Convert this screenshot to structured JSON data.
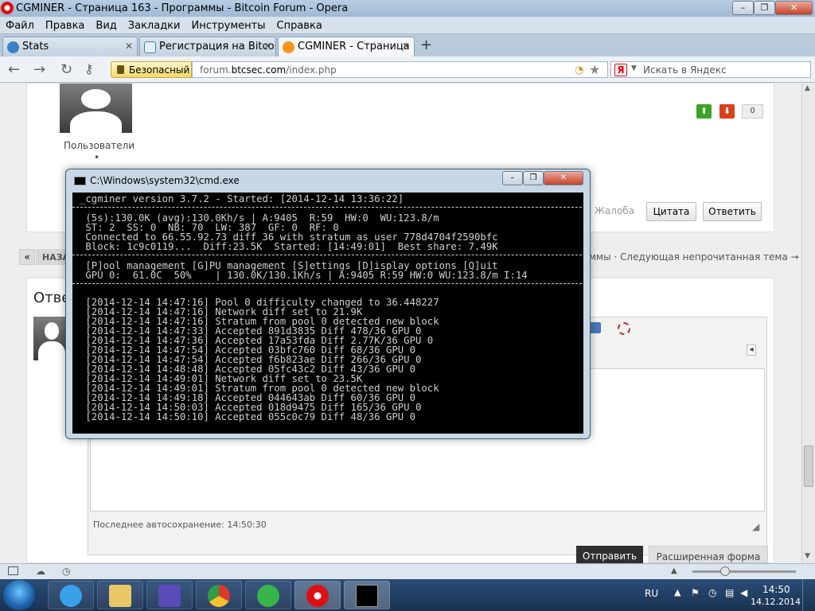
{
  "window": {
    "title": "CGMINER - Страница 163 - Программы - Bitcoin Forum - Opera",
    "controls": [
      "–",
      "❐",
      "✕"
    ]
  },
  "menu": [
    "Файл",
    "Правка",
    "Вид",
    "Закладки",
    "Инструменты",
    "Справка"
  ],
  "tabs": [
    {
      "label": "Stats",
      "active": false
    },
    {
      "label": "Регистрация на Bitcoi...",
      "active": false
    },
    {
      "label": "CGMINER - Страница ...",
      "active": true
    }
  ],
  "newtab": "+",
  "address": {
    "security": "Безопасный",
    "host": "forum.",
    "domain": "btcsec.com",
    "path": "/index.php",
    "search_placeholder": "Искать в Яндекс",
    "search_engine": "Я"
  },
  "forum": {
    "user_group": "Пользователи",
    "bullet": "•",
    "rating": "0",
    "complaint": "Жалоба",
    "quote": "Цитата",
    "reply": "Ответить",
    "prev_arrow": "«",
    "prev_label": "НАЗА",
    "next_text": "ммы · Следующая непрочитанная тема →",
    "reply_heading": "Отве",
    "autosave": "Последнее автосохранение: 14:50:30",
    "send": "Отправить",
    "extended": "Расширенная форма"
  },
  "cmd": {
    "title": "C:\\Windows\\system32\\cmd.exe",
    "header": "_cgminer version 3.7.2 - Started: [2014-12-14 13:36:22]",
    "status": [
      " (5s):130.0K (avg):130.0Kh/s | A:9405  R:59  HW:0  WU:123.8/m",
      " ST: 2  SS: 0  NB: 70  LW: 387  GF: 0  RF: 0",
      " Connected to 66.55.92.73 diff 36 with stratum as user 778d4704f2590bfc",
      " Block: 1c9c0119...  Diff:23.5K  Started: [14:49:01]  Best share: 7.49K"
    ],
    "menu_line": " [P]ool management [G]PU management [S]ettings [D]isplay options [Q]uit",
    "gpu_line": " GPU 0:  61.0C  50%    | 130.0K/130.1Kh/s | A:9405 R:59 HW:0 WU:123.8/m I:14",
    "log": [
      " [2014-12-14 14:47:16] Pool 0 difficulty changed to 36.448227",
      " [2014-12-14 14:47:16] Network diff set to 21.9K",
      " [2014-12-14 14:47:16] Stratum from pool 0 detected new block",
      " [2014-12-14 14:47:33] Accepted 891d3835 Diff 478/36 GPU 0",
      " [2014-12-14 14:47:36] Accepted 17a53fda Diff 2.77K/36 GPU 0",
      " [2014-12-14 14:47:54] Accepted 03bfc760 Diff 68/36 GPU 0",
      " [2014-12-14 14:47:54] Accepted f6b823ae Diff 266/36 GPU 0",
      " [2014-12-14 14:48:48] Accepted 05fc43c2 Diff 43/36 GPU 0",
      " [2014-12-14 14:49:01] Network diff set to 23.5K",
      " [2014-12-14 14:49:01] Stratum from pool 0 detected new block",
      " [2014-12-14 14:49:18] Accepted 044643ab Diff 60/36 GPU 0",
      " [2014-12-14 14:50:03] Accepted 018d9475 Diff 165/36 GPU 0",
      " [2014-12-14 14:50:10] Accepted 055c0c79 Diff 48/36 GPU 0"
    ]
  },
  "taskbar": {
    "lang": "RU",
    "time": "14:50",
    "date": "14.12.2014"
  },
  "colors": {
    "accent": "#1a5fa8",
    "vote_up": "#3ba325",
    "vote_down": "#d9411b",
    "send_button": "#2f2f2f"
  }
}
